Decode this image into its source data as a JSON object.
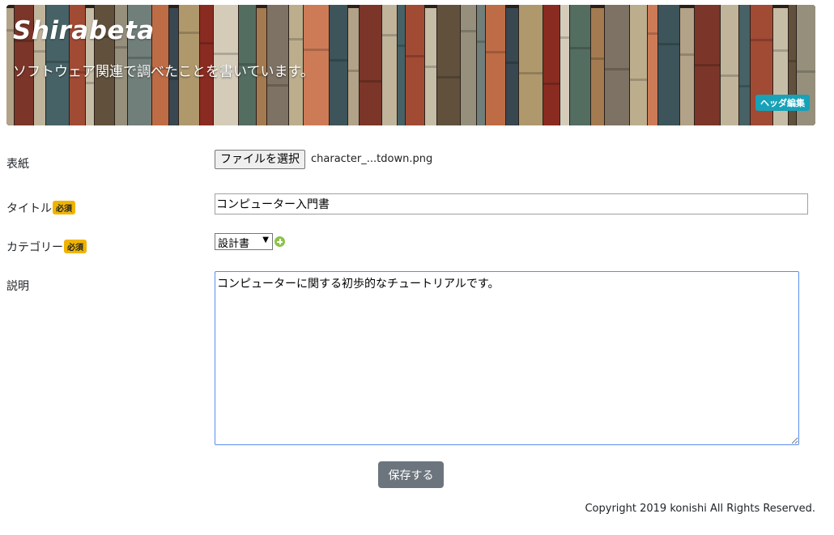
{
  "header": {
    "title": "Shirabeta",
    "subtitle": "ソフトウェア関連で調べたことを書いています。",
    "edit_label": "ヘッダ編集"
  },
  "form": {
    "required_badge": "必須",
    "cover": {
      "label": "表紙",
      "button_label": "ファイルを選択",
      "file_name": "character_...tdown.png"
    },
    "title": {
      "label": "タイトル",
      "value": "コンピューター入門書"
    },
    "category": {
      "label": "カテゴリー",
      "selected": "設計書",
      "add_icon": "plus-circle-icon"
    },
    "description": {
      "label": "説明",
      "value": "コンピューターに関する初歩的なチュートリアルです。"
    },
    "save_label": "保存する"
  },
  "footer": {
    "copyright": "Copyright 2019 konishi All Rights Reserved."
  },
  "colors": {
    "edit_badge": "#17a2b8",
    "required_badge": "#f0b400",
    "save_button": "#6c757d",
    "focus_border": "#5b8def",
    "add_icon": "#8bc34a"
  }
}
